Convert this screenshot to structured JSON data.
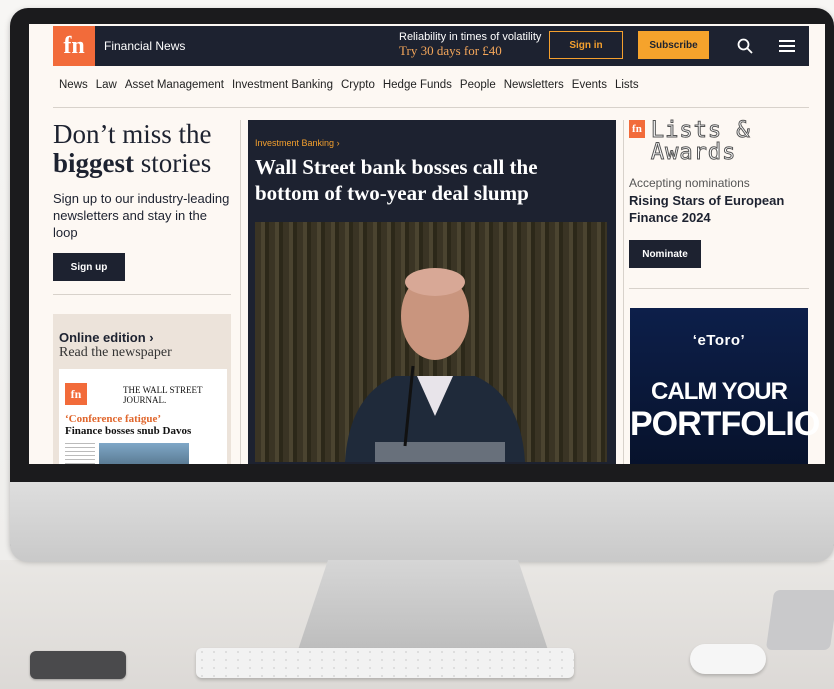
{
  "topbar": {
    "logo": "fn",
    "brand": "Financial News",
    "promo_line1": "Reliability in times of volatility",
    "promo_line2": "Try 30 days for £40",
    "signin_label": "Sign in",
    "subscribe_label": "Subscribe",
    "search_icon": "search-icon",
    "menu_icon": "hamburger-menu-icon"
  },
  "nav": [
    "News",
    "Law",
    "Asset Management",
    "Investment Banking",
    "Crypto",
    "Hedge Funds",
    "People",
    "Newsletters",
    "Events",
    "Lists"
  ],
  "left": {
    "dont_miss": "Don’t miss the",
    "biggest": "biggest",
    "stories": "stories",
    "signup_text": "Sign up to our industry-leading newsletters and stay in the loop",
    "signup_button": "Sign up",
    "online_title": "Online edition",
    "online_sub": "Read the newspaper",
    "paper_logo": "fn",
    "paper_masthead": "THE WALL STREET JOURNAL.",
    "paper_kicker": "‘Conference fatigue’",
    "paper_headline": "Finance bosses snub Davos"
  },
  "main": {
    "kicker": "Investment Banking",
    "headline": "Wall Street bank bosses call the bottom of two-year deal slump"
  },
  "right": {
    "lists_logo": "fn",
    "lists_title": "Lists & Awards",
    "accepting": "Accepting nominations",
    "rising": "Rising Stars of European Finance 2024",
    "nominate": "Nominate",
    "ad_brand": "‘eToro’",
    "ad_line1": "CALM YOUR",
    "ad_line2": "PORTFOLIO"
  },
  "colors": {
    "navy": "#1d2230",
    "orange": "#f26b3a",
    "gold": "#f4a02e"
  }
}
